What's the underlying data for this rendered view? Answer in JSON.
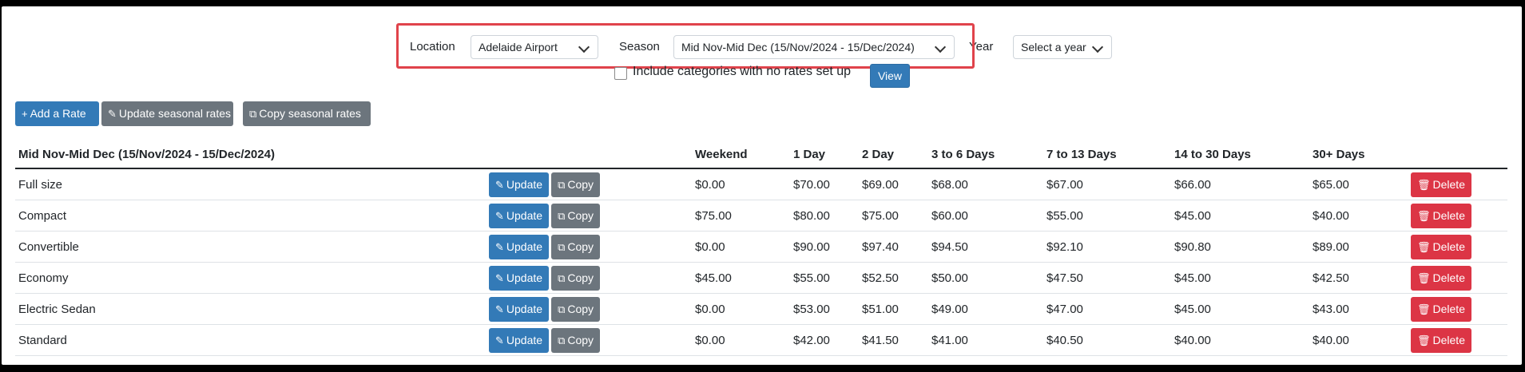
{
  "filters": {
    "location_label": "Location",
    "location_value": "Adelaide Airport",
    "season_label": "Season",
    "season_value": "Mid Nov-Mid Dec (15/Nov/2024 - 15/Dec/2024)",
    "year_label": "Year",
    "year_value": "Select a year",
    "include_label": "Include categories with no rates set up",
    "include_checked": false,
    "view_label": "View"
  },
  "toolbar": {
    "add_label": "Add a Rate",
    "update_seasonal_label": "Update seasonal rates",
    "copy_seasonal_label": "Copy seasonal rates"
  },
  "table": {
    "headers": [
      "Mid Nov-Mid Dec (15/Nov/2024 - 15/Dec/2024)",
      "",
      "Weekend",
      "1 Day",
      "2 Day",
      "3 to 6 Days",
      "7 to 13 Days",
      "14 to 30 Days",
      "30+ Days",
      ""
    ],
    "row_actions": {
      "update": "Update",
      "copy": "Copy",
      "delete": "Delete"
    },
    "rows": [
      {
        "name": "Full size",
        "rates": [
          "$0.00",
          "$70.00",
          "$69.00",
          "$68.00",
          "$67.00",
          "$66.00",
          "$65.00"
        ]
      },
      {
        "name": "Compact",
        "rates": [
          "$75.00",
          "$80.00",
          "$75.00",
          "$60.00",
          "$55.00",
          "$45.00",
          "$40.00"
        ]
      },
      {
        "name": "Convertible",
        "rates": [
          "$0.00",
          "$90.00",
          "$97.40",
          "$94.50",
          "$92.10",
          "$90.80",
          "$89.00"
        ]
      },
      {
        "name": "Economy",
        "rates": [
          "$45.00",
          "$55.00",
          "$52.50",
          "$50.00",
          "$47.50",
          "$45.00",
          "$42.50"
        ]
      },
      {
        "name": "Electric Sedan",
        "rates": [
          "$0.00",
          "$53.00",
          "$51.00",
          "$49.00",
          "$47.00",
          "$45.00",
          "$43.00"
        ]
      },
      {
        "name": "Standard",
        "rates": [
          "$0.00",
          "$42.00",
          "$41.50",
          "$41.00",
          "$40.50",
          "$40.00",
          "$40.00"
        ]
      }
    ]
  },
  "colors": {
    "primary": "#337ab7",
    "secondary": "#6c757d",
    "danger": "#dc3545",
    "highlight": "#e0434b"
  }
}
